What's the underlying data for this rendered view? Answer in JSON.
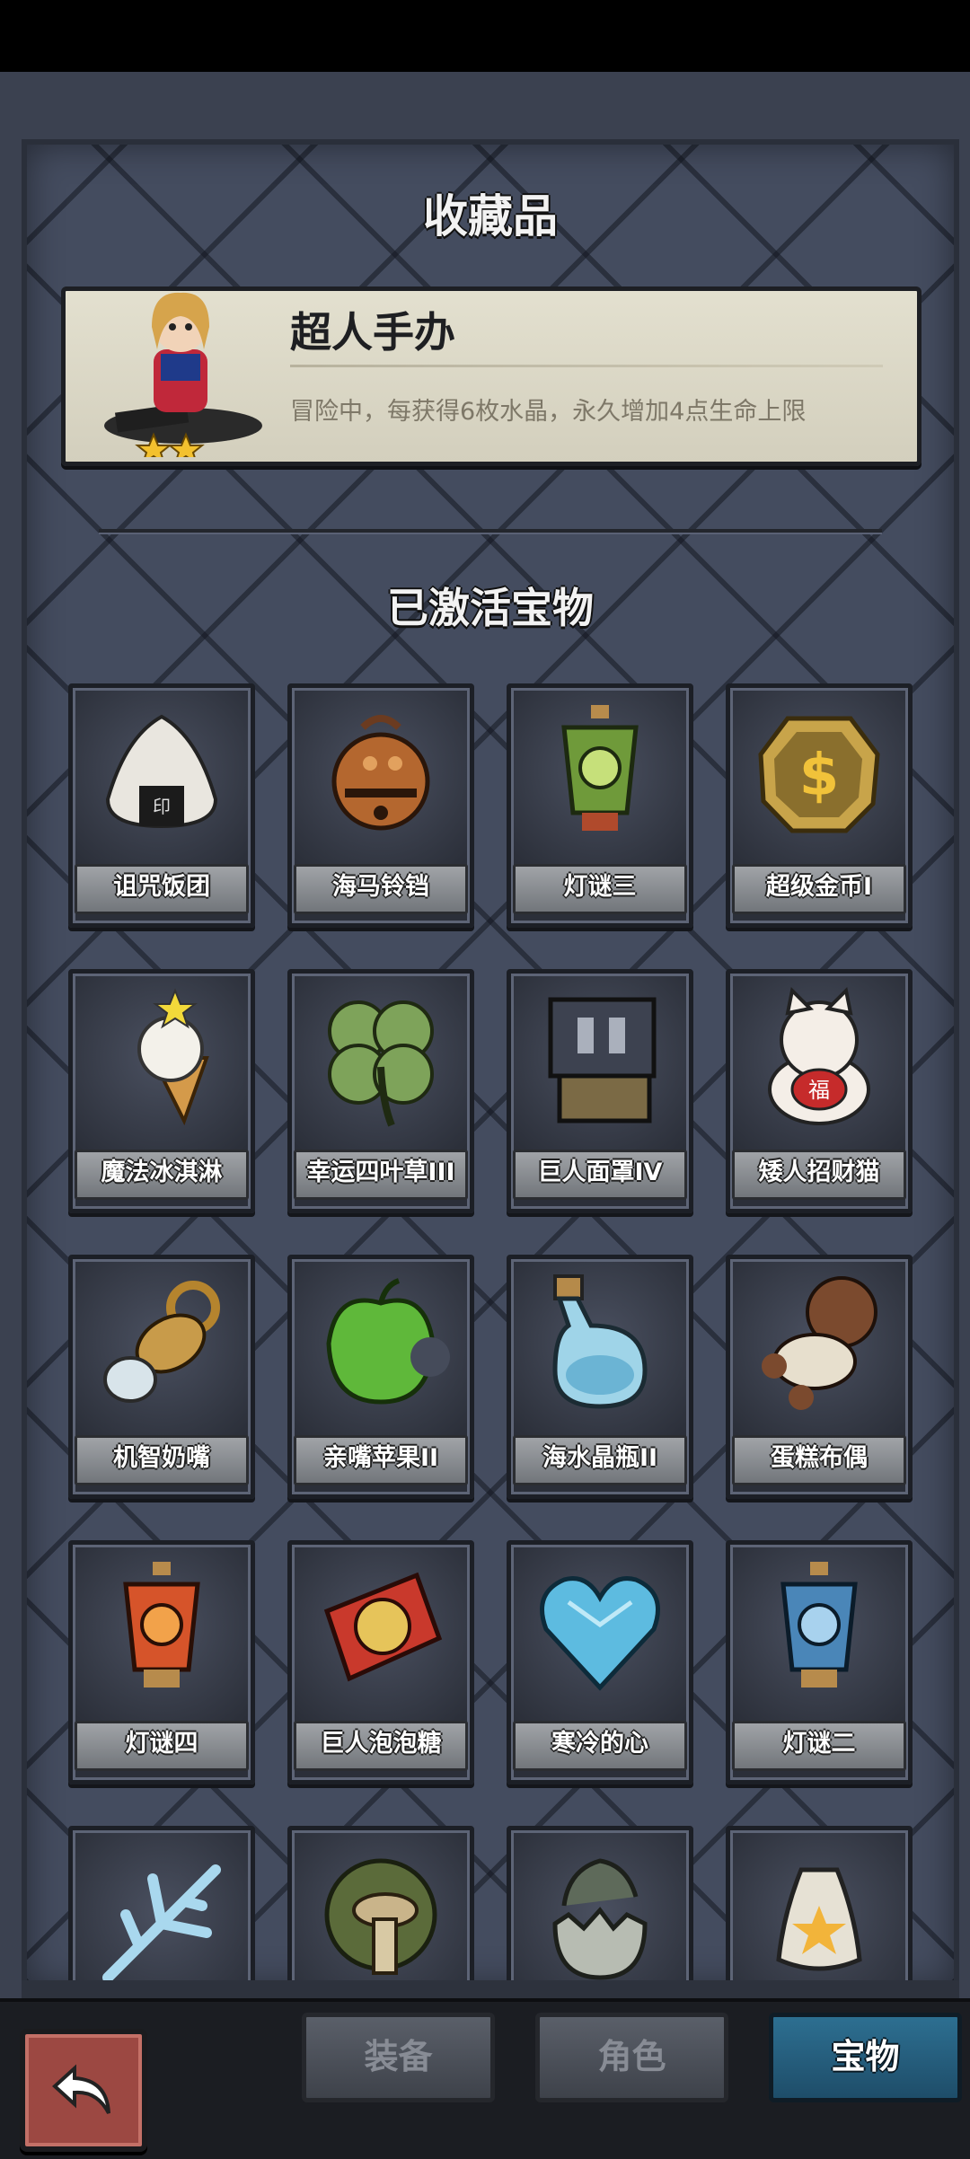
{
  "headings": {
    "collection": "收藏品",
    "activated": "已激活宝物"
  },
  "collectible": {
    "name": "超人手办",
    "description": "冒险中，每获得6枚水晶，永久增加4点生命上限",
    "stars": 2
  },
  "treasures": [
    {
      "label": "诅咒饭团",
      "icon": "rice-ball-icon"
    },
    {
      "label": "海马铃铛",
      "icon": "bell-icon"
    },
    {
      "label": "灯谜三",
      "icon": "green-lantern-icon"
    },
    {
      "label": "超级金币I",
      "icon": "gold-coin-icon"
    },
    {
      "label": "魔法冰淇淋",
      "icon": "ice-cream-icon"
    },
    {
      "label": "幸运四叶草III",
      "icon": "four-leaf-clover-icon"
    },
    {
      "label": "巨人面罩IV",
      "icon": "giant-mask-icon"
    },
    {
      "label": "矮人招财猫",
      "icon": "lucky-cat-icon"
    },
    {
      "label": "机智奶嘴",
      "icon": "pacifier-icon"
    },
    {
      "label": "亲嘴苹果II",
      "icon": "bitten-apple-icon"
    },
    {
      "label": "海水晶瓶II",
      "icon": "bottle-icon"
    },
    {
      "label": "蛋糕布偶",
      "icon": "cake-doll-icon"
    },
    {
      "label": "灯谜四",
      "icon": "red-lantern-icon"
    },
    {
      "label": "巨人泡泡糖",
      "icon": "bubble-gum-icon"
    },
    {
      "label": "寒冷的心",
      "icon": "ice-heart-icon"
    },
    {
      "label": "灯谜二",
      "icon": "blue-lantern-icon"
    },
    {
      "label": "",
      "icon": "ice-coral-icon"
    },
    {
      "label": "",
      "icon": "mushroom-icon"
    },
    {
      "label": "",
      "icon": "broken-egg-icon"
    },
    {
      "label": "",
      "icon": "star-pouch-icon"
    }
  ],
  "tabs": [
    {
      "label": "装备",
      "active": false
    },
    {
      "label": "角色",
      "active": false
    },
    {
      "label": "宝物",
      "active": true
    }
  ],
  "colors": {
    "panel": "#444c5f",
    "active_tab": "#2d6f91",
    "back_button": "#9c4842"
  }
}
